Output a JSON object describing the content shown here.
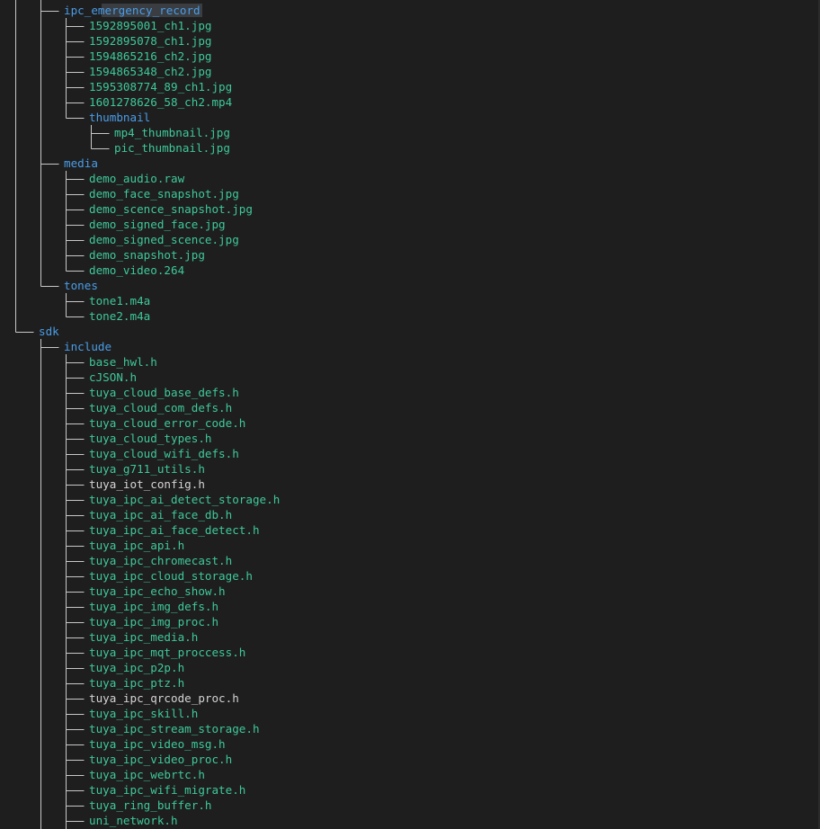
{
  "colors": {
    "background": "#1e1e1e",
    "directory": "#4a9de8",
    "file": "#3ec99a",
    "plain_file": "#d4d4d4",
    "guide": "#c8c8c8",
    "selection": "#3a3d41"
  },
  "tree": [
    {
      "label": "ipc_emergency_record",
      "depth": 2,
      "kind": "dir",
      "selected": true
    },
    {
      "label": "1592895001_ch1.jpg",
      "depth": 3,
      "kind": "file"
    },
    {
      "label": "1592895078_ch1.jpg",
      "depth": 3,
      "kind": "file"
    },
    {
      "label": "1594865216_ch2.jpg",
      "depth": 3,
      "kind": "file"
    },
    {
      "label": "1594865348_ch2.jpg",
      "depth": 3,
      "kind": "file"
    },
    {
      "label": "1595308774_89_ch1.jpg",
      "depth": 3,
      "kind": "file"
    },
    {
      "label": "1601278626_58_ch2.mp4",
      "depth": 3,
      "kind": "file"
    },
    {
      "label": "thumbnail",
      "depth": 3,
      "kind": "dir"
    },
    {
      "label": "mp4_thumbnail.jpg",
      "depth": 4,
      "kind": "file"
    },
    {
      "label": "pic_thumbnail.jpg",
      "depth": 4,
      "kind": "file"
    },
    {
      "label": "media",
      "depth": 2,
      "kind": "dir"
    },
    {
      "label": "demo_audio.raw",
      "depth": 3,
      "kind": "file"
    },
    {
      "label": "demo_face_snapshot.jpg",
      "depth": 3,
      "kind": "file"
    },
    {
      "label": "demo_scence_snapshot.jpg",
      "depth": 3,
      "kind": "file"
    },
    {
      "label": "demo_signed_face.jpg",
      "depth": 3,
      "kind": "file"
    },
    {
      "label": "demo_signed_scence.jpg",
      "depth": 3,
      "kind": "file"
    },
    {
      "label": "demo_snapshot.jpg",
      "depth": 3,
      "kind": "file"
    },
    {
      "label": "demo_video.264",
      "depth": 3,
      "kind": "file"
    },
    {
      "label": "tones",
      "depth": 2,
      "kind": "dir"
    },
    {
      "label": "tone1.m4a",
      "depth": 3,
      "kind": "file"
    },
    {
      "label": "tone2.m4a",
      "depth": 3,
      "kind": "file"
    },
    {
      "label": "sdk",
      "depth": 1,
      "kind": "dir"
    },
    {
      "label": "include",
      "depth": 2,
      "kind": "dir"
    },
    {
      "label": "base_hwl.h",
      "depth": 3,
      "kind": "file"
    },
    {
      "label": "cJSON.h",
      "depth": 3,
      "kind": "file"
    },
    {
      "label": "tuya_cloud_base_defs.h",
      "depth": 3,
      "kind": "file"
    },
    {
      "label": "tuya_cloud_com_defs.h",
      "depth": 3,
      "kind": "file"
    },
    {
      "label": "tuya_cloud_error_code.h",
      "depth": 3,
      "kind": "file"
    },
    {
      "label": "tuya_cloud_types.h",
      "depth": 3,
      "kind": "file"
    },
    {
      "label": "tuya_cloud_wifi_defs.h",
      "depth": 3,
      "kind": "file"
    },
    {
      "label": "tuya_g711_utils.h",
      "depth": 3,
      "kind": "file"
    },
    {
      "label": "tuya_iot_config.h",
      "depth": 3,
      "kind": "plain"
    },
    {
      "label": "tuya_ipc_ai_detect_storage.h",
      "depth": 3,
      "kind": "file"
    },
    {
      "label": "tuya_ipc_ai_face_db.h",
      "depth": 3,
      "kind": "file"
    },
    {
      "label": "tuya_ipc_ai_face_detect.h",
      "depth": 3,
      "kind": "file"
    },
    {
      "label": "tuya_ipc_api.h",
      "depth": 3,
      "kind": "file"
    },
    {
      "label": "tuya_ipc_chromecast.h",
      "depth": 3,
      "kind": "file"
    },
    {
      "label": "tuya_ipc_cloud_storage.h",
      "depth": 3,
      "kind": "file"
    },
    {
      "label": "tuya_ipc_echo_show.h",
      "depth": 3,
      "kind": "file"
    },
    {
      "label": "tuya_ipc_img_defs.h",
      "depth": 3,
      "kind": "file"
    },
    {
      "label": "tuya_ipc_img_proc.h",
      "depth": 3,
      "kind": "file"
    },
    {
      "label": "tuya_ipc_media.h",
      "depth": 3,
      "kind": "file"
    },
    {
      "label": "tuya_ipc_mqt_proccess.h",
      "depth": 3,
      "kind": "file"
    },
    {
      "label": "tuya_ipc_p2p.h",
      "depth": 3,
      "kind": "file"
    },
    {
      "label": "tuya_ipc_ptz.h",
      "depth": 3,
      "kind": "file"
    },
    {
      "label": "tuya_ipc_qrcode_proc.h",
      "depth": 3,
      "kind": "plain"
    },
    {
      "label": "tuya_ipc_skill.h",
      "depth": 3,
      "kind": "file"
    },
    {
      "label": "tuya_ipc_stream_storage.h",
      "depth": 3,
      "kind": "file"
    },
    {
      "label": "tuya_ipc_video_msg.h",
      "depth": 3,
      "kind": "file"
    },
    {
      "label": "tuya_ipc_video_proc.h",
      "depth": 3,
      "kind": "file"
    },
    {
      "label": "tuya_ipc_webrtc.h",
      "depth": 3,
      "kind": "file"
    },
    {
      "label": "tuya_ipc_wifi_migrate.h",
      "depth": 3,
      "kind": "file"
    },
    {
      "label": "tuya_ring_buffer.h",
      "depth": 3,
      "kind": "file"
    },
    {
      "label": "uni_network.h",
      "depth": 3,
      "kind": "file"
    }
  ]
}
